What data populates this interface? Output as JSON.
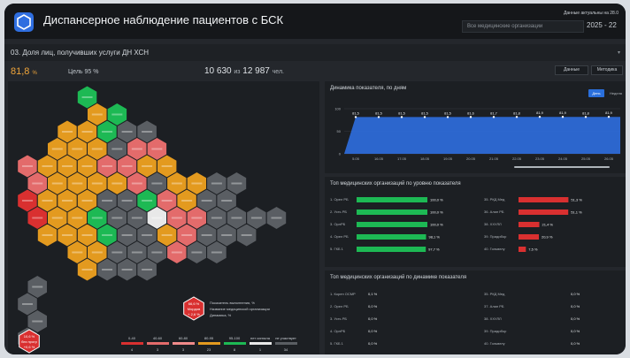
{
  "header": {
    "title": "Диспансерное наблюдение пациентов с БСК",
    "data_note": "Данные актуальны на 28.0",
    "org_select_placeholder": "Все медицинские организации",
    "period": "2025 - 22"
  },
  "indicator": {
    "title": "03. Доля лиц, получивших услуги ДН ХСН",
    "value": "81,8",
    "value_unit": "%",
    "target": "Цель 95 %",
    "numerator": "10 630",
    "of": "из",
    "denominator": "12 987",
    "unit": "чел.",
    "data_button": "Данные",
    "method_button": "Методика"
  },
  "colors": {
    "green": "#1db954",
    "orange": "#e39a1f",
    "pink": "#e36b6b",
    "red": "#d93030",
    "gray": "#5a5e63",
    "white": "#e8e8e8",
    "blue": "#2f6ee0",
    "accent": "#f0a53a"
  },
  "map": {
    "legend": {
      "hex_label": "66,6 %",
      "hex_sub": "Мордов",
      "hex_sub2": "+ 2,6 %",
      "line1": "Показатель выполнения, %",
      "line2": "Название медицинской организации",
      "line3": "Динамика, %"
    },
    "corner_badge": {
      "line1": "10,6 %",
      "line2": "без прогр",
      "line3": "+0,6 %"
    },
    "scale": [
      {
        "label": "0-40",
        "count": "4",
        "color": "#d93030"
      },
      {
        "label": "40-60",
        "count": "3",
        "color": "#e36b6b"
      },
      {
        "label": "60-80",
        "count": "3",
        "color": "#f08a8a"
      },
      {
        "label": "80-95",
        "count": "23",
        "color": "#e39a1f"
      },
      {
        "label": "95-100",
        "count": "8",
        "color": "#1db954"
      },
      {
        "label": "нет сигнала",
        "count": "1",
        "color": "#e8e8e8"
      },
      {
        "label": "не участвует",
        "count": "34",
        "color": "#5a5e63"
      }
    ]
  },
  "dynamics": {
    "title": "Динамика показателя, по дням",
    "day_label": "День",
    "week_label": "Неделя"
  },
  "top_orgs": {
    "title": "Топ медицинских организаций по уровню показателя"
  },
  "dyn_rank": {
    "title": "Топ медицинских организаций по динамике показателя"
  },
  "chart_data": [
    {
      "type": "area",
      "title": "Динамика показателя, по дням",
      "x": [
        "5.05",
        "16.05",
        "17.05",
        "18.05",
        "19.05",
        "20.05",
        "21.05",
        "22.05",
        "23.05",
        "24.05",
        "25.05",
        "26.05"
      ],
      "values": [
        81.5,
        81.5,
        81.5,
        81.5,
        81.5,
        81.6,
        81.7,
        81.8,
        81.9,
        81.9,
        81.8,
        81.9
      ],
      "value_labels": [
        "81,5",
        "81,5",
        "81,5",
        "81,5",
        "81,5",
        "81,6",
        "81,7",
        "81,8",
        "81,9",
        "81,9",
        "81,8",
        "81,9"
      ],
      "yticks": [
        "0",
        "50",
        "100"
      ],
      "ylim": [
        0,
        100
      ]
    },
    {
      "type": "bar",
      "title": "Топ медицинских организаций по уровню показателя",
      "left": [
        {
          "label": "1. Орел РБ",
          "value": 100.0,
          "value_label": "100,0 %",
          "color": "#1db954"
        },
        {
          "label": "2. Усть РБ",
          "value": 100.0,
          "value_label": "100,0 %",
          "color": "#1db954"
        },
        {
          "label": "3. ОрлРБ",
          "value": 100.0,
          "value_label": "100,0 %",
          "color": "#1db954"
        },
        {
          "label": "4. Орел РБ",
          "value": 98.1,
          "value_label": "98,1 %",
          "color": "#1db954"
        },
        {
          "label": "5. ГКБ 1",
          "value": 97.7,
          "value_label": "97,7 %",
          "color": "#1db954"
        }
      ],
      "right": [
        {
          "label": "35. РКД Мед",
          "value": 51.3,
          "value_label": "51,3 %",
          "color": "#d93030"
        },
        {
          "label": "36. Алан РБ",
          "value": 51.1,
          "value_label": "51,1 %",
          "color": "#d93030"
        },
        {
          "label": "38. ХХУЛЛ",
          "value": 21.4,
          "value_label": "21,4 %",
          "color": "#d93030"
        },
        {
          "label": "39. Придибор",
          "value": 20.9,
          "value_label": "20,9 %",
          "color": "#d93030"
        },
        {
          "label": "40. Гольвелу",
          "value": 7.5,
          "value_label": "7,5 %",
          "color": "#d93030"
        }
      ],
      "xlim": [
        0,
        100
      ]
    },
    {
      "type": "bar",
      "title": "Топ медицинских организаций по динамике показателя",
      "left": [
        {
          "label": "1. Корен ОСМР",
          "value_label": "0,1 %"
        },
        {
          "label": "2. Орел РБ",
          "value_label": "0,0 %"
        },
        {
          "label": "3. Усть РБ",
          "value_label": "0,0 %"
        },
        {
          "label": "4. ОрлРБ",
          "value_label": "0,0 %"
        },
        {
          "label": "5. ГКБ 1",
          "value_label": "0,0 %"
        }
      ],
      "right": [
        {
          "label": "35. РКД Мед",
          "value_label": "0,0 %"
        },
        {
          "label": "37. Алан РБ",
          "value_label": "0,0 %"
        },
        {
          "label": "38. ХХУЛЛ",
          "value_label": "0,0 %"
        },
        {
          "label": "39. Придибор",
          "value_label": "0,0 %"
        },
        {
          "label": "40. Гольвелу",
          "value_label": "0,0 %"
        }
      ]
    }
  ]
}
